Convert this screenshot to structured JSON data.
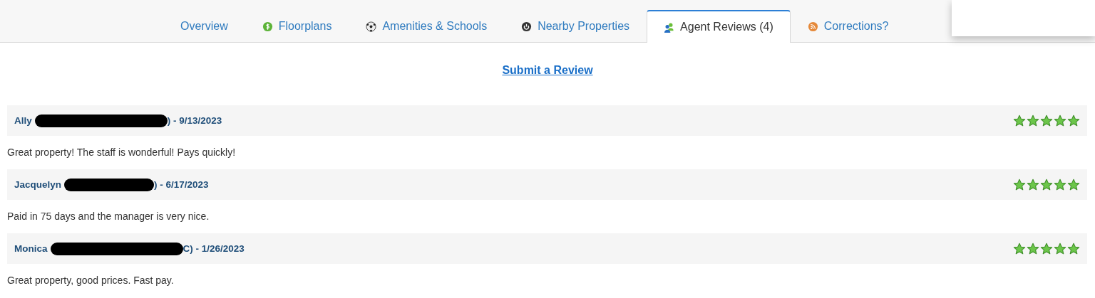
{
  "tabs": [
    {
      "label": "Overview",
      "kind": "plain",
      "selected": false
    },
    {
      "label": "Floorplans",
      "kind": "dollar",
      "selected": false
    },
    {
      "label": "Amenities & Schools",
      "kind": "ball",
      "selected": false
    },
    {
      "label": "Nearby Properties",
      "kind": "power",
      "selected": false
    },
    {
      "label": "Agent Reviews (4)",
      "kind": "people",
      "selected": true
    },
    {
      "label": "Corrections?",
      "kind": "feed",
      "selected": false
    }
  ],
  "submit_link": "Submit a Review",
  "reviews": [
    {
      "name": "Ally",
      "redacted": true,
      "after": ") - 9/13/2023",
      "stars": 5,
      "comment": "Great property! The staff is wonderful! Pays quickly!"
    },
    {
      "name": "Jacquelyn",
      "redacted": true,
      "after": ") - 6/17/2023",
      "stars": 5,
      "comment": "Paid in 75 days and the manager is very nice."
    },
    {
      "name": "Monica",
      "redacted": true,
      "after": "C) - 1/26/2023",
      "stars": 5,
      "comment": "Great property, good prices. Fast pay."
    }
  ]
}
